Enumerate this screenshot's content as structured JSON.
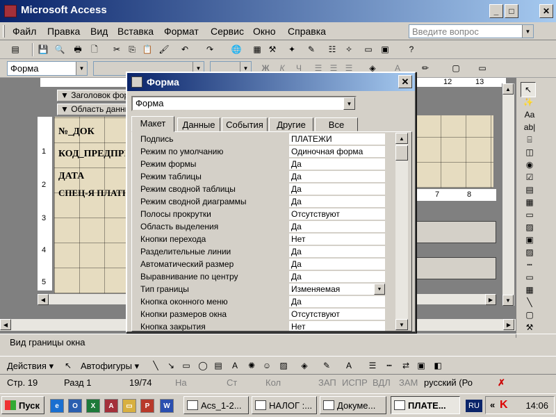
{
  "app": {
    "title": "Microsoft Access",
    "window_buttons": [
      "_",
      "□",
      "✕"
    ]
  },
  "menu": {
    "items": [
      "Файл",
      "Правка",
      "Вид",
      "Вставка",
      "Формат",
      "Сервис",
      "Окно",
      "Справка"
    ],
    "help_placeholder": "Введите вопрос"
  },
  "format_toolbar": {
    "object_combo": "Форма",
    "bold": "Ж",
    "italic": "К",
    "underline": "Ч",
    "font_color_letter": "A"
  },
  "design": {
    "sections": [
      "Заголовок формы",
      "Область данных"
    ],
    "field_labels": [
      "№_ДОК",
      "КОД_ПРЕДПРИЯТИЯ",
      "ДАТА",
      "СПЕЦ-Я ПЛАТЕЖА"
    ],
    "vertical_ruler": [
      "1",
      "2",
      "3",
      "4",
      "5"
    ],
    "right_ruler": [
      "7",
      "8"
    ],
    "top_ruler": [
      "12",
      "13"
    ]
  },
  "dialog": {
    "title": "Форма",
    "object_selector": "Форма",
    "tabs": [
      "Макет",
      "Данные",
      "События",
      "Другие",
      "Все"
    ],
    "active_tab": "Макет",
    "properties": [
      {
        "name": "Подпись",
        "value": "ПЛАТЕЖИ"
      },
      {
        "name": "Режим по умолчанию",
        "value": "Одиночная форма"
      },
      {
        "name": "Режим формы",
        "value": "Да"
      },
      {
        "name": "Режим таблицы",
        "value": "Да"
      },
      {
        "name": "Режим сводной таблицы",
        "value": "Да"
      },
      {
        "name": "Режим сводной диаграммы",
        "value": "Да"
      },
      {
        "name": "Полосы прокрутки",
        "value": "Отсутствуют"
      },
      {
        "name": "Область выделения",
        "value": "Да"
      },
      {
        "name": "Кнопки перехода",
        "value": "Нет"
      },
      {
        "name": "Разделительные линии",
        "value": "Да"
      },
      {
        "name": "Автоматический размер",
        "value": "Да"
      },
      {
        "name": "Выравнивание по центру",
        "value": "Да"
      },
      {
        "name": "Тип границы",
        "value": "Изменяемая"
      },
      {
        "name": "Кнопка оконного меню",
        "value": "Да"
      },
      {
        "name": "Кнопки размеров окна",
        "value": "Отсутствуют"
      },
      {
        "name": "Кнопка закрытия",
        "value": "Нет"
      }
    ]
  },
  "toolbox": {
    "items": [
      "pointer",
      "wizard",
      "label Aa",
      "textbox ab|",
      "option-group",
      "toggle",
      "option",
      "checkbox",
      "combo",
      "list",
      "button",
      "image",
      "unbound-frame",
      "bound-frame",
      "page-break",
      "tab",
      "subform",
      "line",
      "rectangle",
      "more"
    ]
  },
  "status_hint": "Вид границы окна",
  "drawing_toolbar": {
    "actions": "Действия",
    "autoshapes": "Автофигуры"
  },
  "statusbar": {
    "page": "Стр. 19",
    "section": "Разд 1",
    "position": "19/74",
    "at": "На",
    "line": "Ст",
    "col": "Кол",
    "rec": "ЗАП",
    "trk": "ИСПР",
    "ext": "ВДЛ",
    "ovr": "ЗАМ",
    "language": "русский (Ро"
  },
  "taskbar": {
    "start": "Пуск",
    "tasks": [
      "Acs_1-2...",
      "НАЛОГ :...",
      "Докуме...",
      "ПЛАТЕ..."
    ],
    "active_task": "ПЛАТЕ...",
    "lang": "RU",
    "clock": "14:06"
  },
  "colors": {
    "title_gradient_start": "#0a246a",
    "title_gradient_end": "#a6caf0",
    "face": "#d4d0c8"
  }
}
